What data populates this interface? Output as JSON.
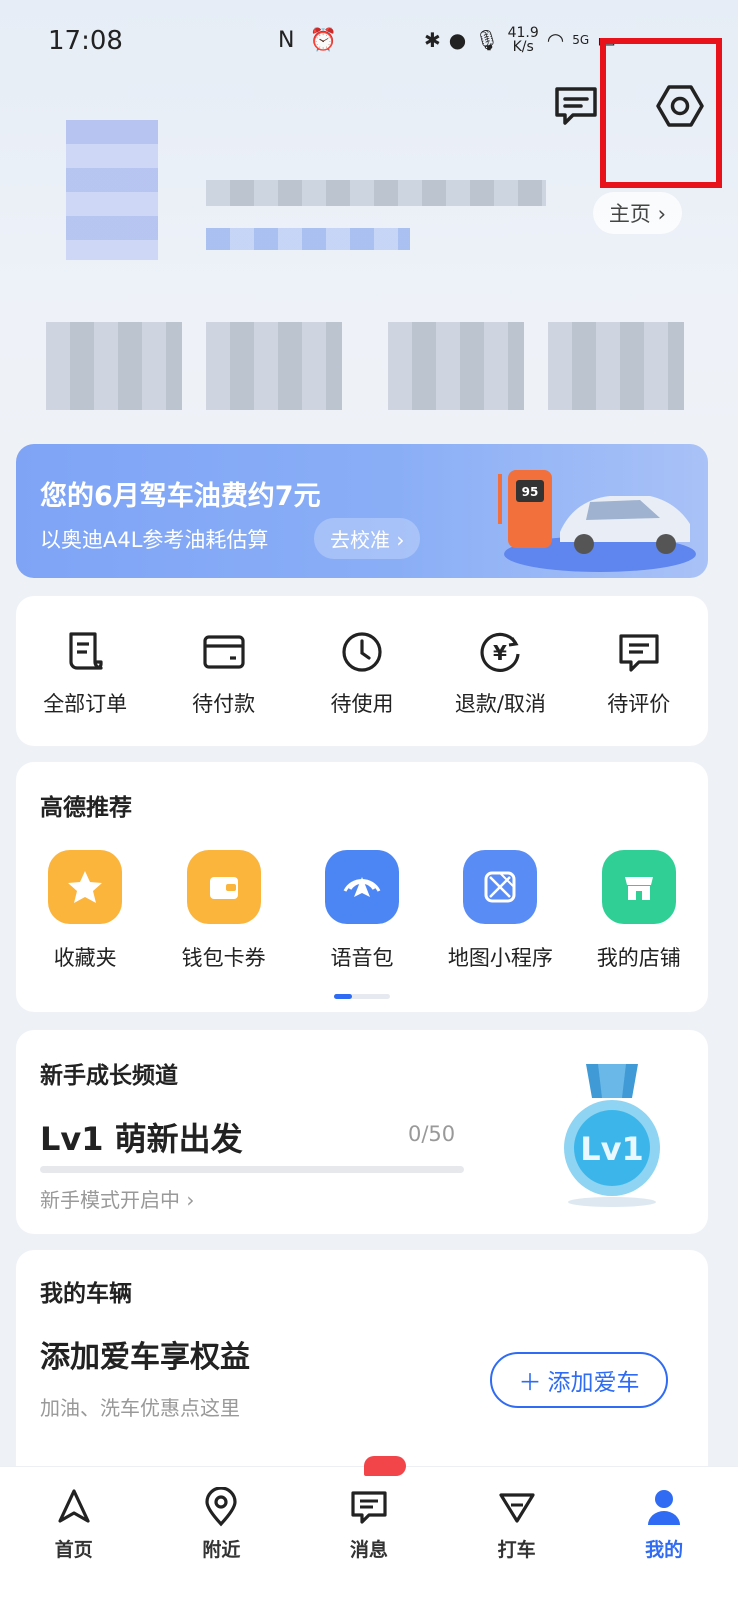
{
  "status_bar": {
    "time": "17:08",
    "mid_icons": "N ⏰",
    "speed_value": "41.9",
    "speed_unit": "K/s",
    "network": "5G"
  },
  "header": {
    "home_link": "主页 ›"
  },
  "fuel_banner": {
    "title": "您的6月驾车油费约7元",
    "subtitle": "以奥迪A4L参考油耗估算",
    "cta": "去校准 ›",
    "pump_label": "95"
  },
  "orders": {
    "items": [
      {
        "label": "全部订单",
        "icon": "receipt-icon"
      },
      {
        "label": "待付款",
        "icon": "card-icon"
      },
      {
        "label": "待使用",
        "icon": "clock-icon"
      },
      {
        "label": "退款/取消",
        "icon": "refund-icon"
      },
      {
        "label": "待评价",
        "icon": "comment-icon"
      }
    ]
  },
  "recommend": {
    "title": "高德推荐",
    "items": [
      {
        "label": "收藏夹",
        "icon": "star-icon",
        "color": "#fbb43c"
      },
      {
        "label": "钱包卡券",
        "icon": "wallet-icon",
        "color": "#fbb43c"
      },
      {
        "label": "语音包",
        "icon": "voice-icon",
        "color": "#4c86f5"
      },
      {
        "label": "地图小程序",
        "icon": "map-app-icon",
        "color": "#5a8cf6"
      },
      {
        "label": "我的店铺",
        "icon": "shop-icon",
        "color": "#2fcf96"
      }
    ],
    "page_index": 1,
    "page_count": 3
  },
  "growth": {
    "title": "新手成长频道",
    "level_title": "Lv1 萌新出发",
    "progress_text": "0/50",
    "progress_fraction": 0,
    "subtitle": "新手模式开启中 ›",
    "medal_text": "Lv1"
  },
  "vehicle": {
    "title": "我的车辆",
    "headline": "添加爱车享权益",
    "subtitle": "加油、洗车优惠点这里",
    "add_button": "添加爱车"
  },
  "tabbar": {
    "tabs": [
      {
        "label": "首页",
        "icon": "navigate-icon"
      },
      {
        "label": "附近",
        "icon": "location-icon"
      },
      {
        "label": "消息",
        "icon": "message-icon"
      },
      {
        "label": "打车",
        "icon": "taxi-icon"
      },
      {
        "label": "我的",
        "icon": "profile-icon",
        "active": true
      }
    ]
  },
  "colors": {
    "accent": "#2f6bf3",
    "highlight": "#e8121b"
  }
}
